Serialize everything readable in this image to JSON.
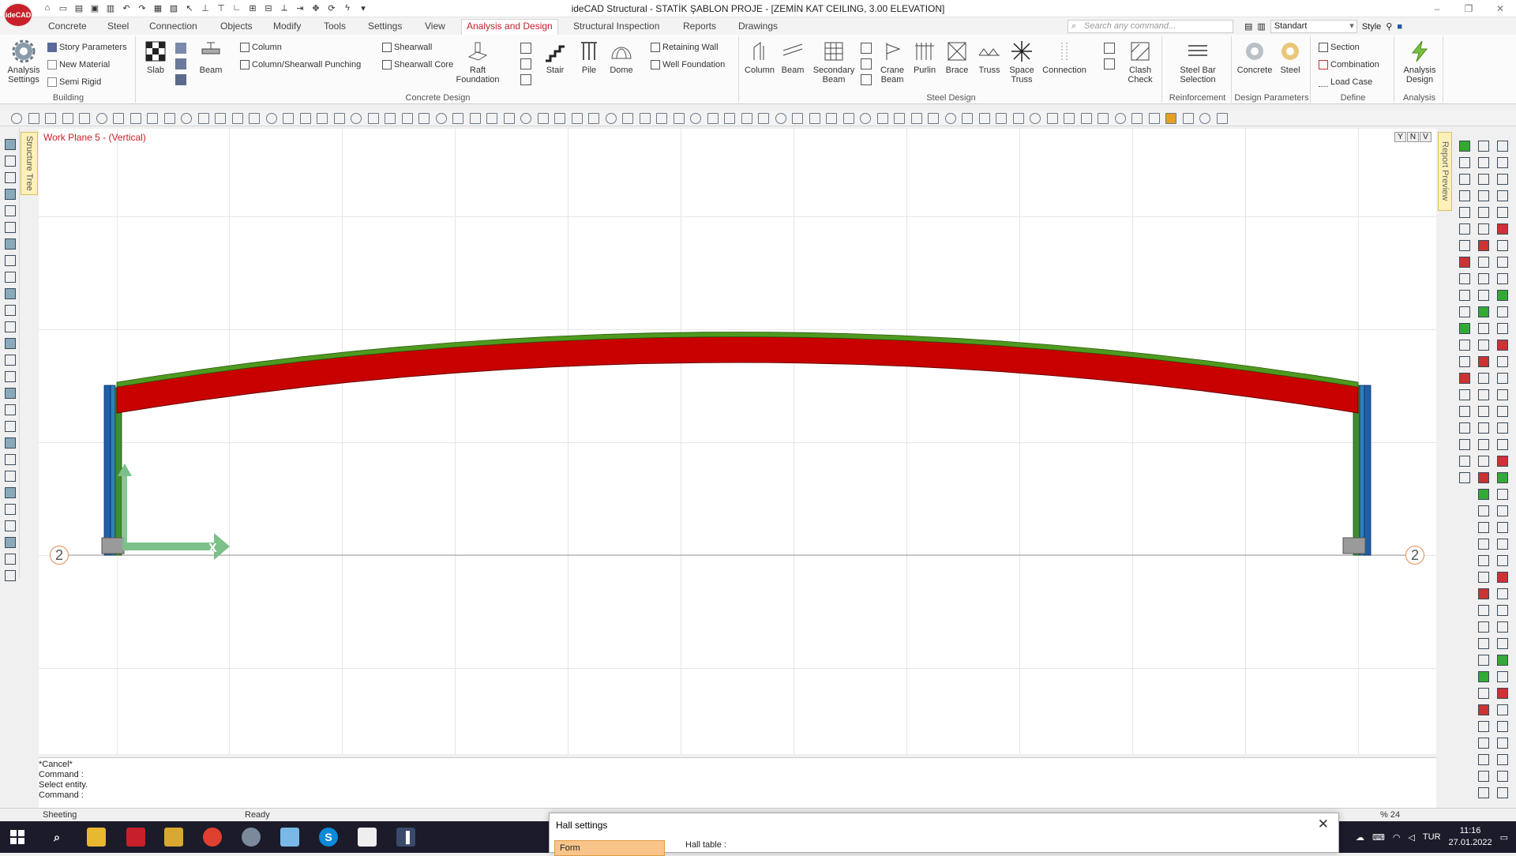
{
  "app": {
    "logo_text": "ideCAD",
    "window_title": "ideCAD Structural - STATİK ŞABLON PROJE - [ZEMİN KAT CEILING,  3.00 ELEVATION]",
    "window_controls": [
      "–",
      "❐",
      "✕"
    ]
  },
  "menu_tabs": [
    "Concrete",
    "Steel",
    "Connection",
    "Objects",
    "Modify",
    "Tools",
    "Settings",
    "View",
    "Analysis and Design",
    "Structural Inspection",
    "Reports",
    "Drawings"
  ],
  "active_tab": "Analysis and Design",
  "search": {
    "placeholder": "Search any command..."
  },
  "style_dropdown": {
    "value": "Standart",
    "label": "Style"
  },
  "ribbon": {
    "building": {
      "label": "Building",
      "analysis_settings": "Analysis Settings",
      "story_parameters": "Story Parameters",
      "new_material": "New Material",
      "semi_rigid": "Semi Rigid"
    },
    "concrete_design": {
      "label": "Concrete Design",
      "slab": "Slab",
      "beam": "Beam",
      "column": "Column",
      "column_shearwall_punching": "Column/Shearwall Punching",
      "shearwall": "Shearwall",
      "shearwall_core": "Shearwall Core",
      "raft_foundation": "Raft Foundation",
      "stair": "Stair",
      "pile": "Pile",
      "dome": "Dome",
      "retaining_wall": "Retaining Wall",
      "well_foundation": "Well Foundation"
    },
    "steel_design": {
      "label": "Steel Design",
      "column": "Column",
      "beam": "Beam",
      "secondary_beam": "Secondary Beam",
      "crane_beam": "Crane Beam",
      "purlin": "Purlin",
      "brace": "Brace",
      "truss": "Truss",
      "space_truss": "Space Truss",
      "connection": "Connection",
      "clash_check": "Clash Check"
    },
    "reinforcement": {
      "label": "Reinforcement",
      "steel_bar_selection": "Steel Bar Selection"
    },
    "design_parameters": {
      "label": "Design Parameters",
      "concrete": "Concrete",
      "steel": "Steel"
    },
    "define": {
      "label": "Define",
      "section": "Section",
      "combination": "Combination",
      "load_case": "Load Case"
    },
    "analysis": {
      "label": "Analysis",
      "analysis_design": "Analysis Design"
    }
  },
  "side_tabs": {
    "structure_tree": "Structure Tree",
    "report_preview": "Report Preview"
  },
  "canvas": {
    "workplane_label": "Work Plane 5 - (Vertical)",
    "axis_bubble_left": "2",
    "axis_bubble_right": "2",
    "axis_x_label": "X",
    "view_buttons": [
      "Y",
      "N",
      "V"
    ],
    "colors": {
      "beam": "#c80000",
      "purlin": "#4f9a1e",
      "column_blue": "#1f5fa8",
      "column_green": "#3e8e2e",
      "axis_arrow": "#7cc08a"
    }
  },
  "command_lines": [
    "*Cancel*",
    "Command :",
    "Select entity.",
    "Command :"
  ],
  "status": {
    "mode": "Sheeting",
    "state": "Ready",
    "zoom": "% 24"
  },
  "hall_dialog": {
    "title": "Hall settings",
    "form_tab": "Form",
    "hall_table_label": "Hall table :"
  },
  "tray": {
    "language": "TUR",
    "time": "11:16",
    "date": "27.01.2022"
  }
}
